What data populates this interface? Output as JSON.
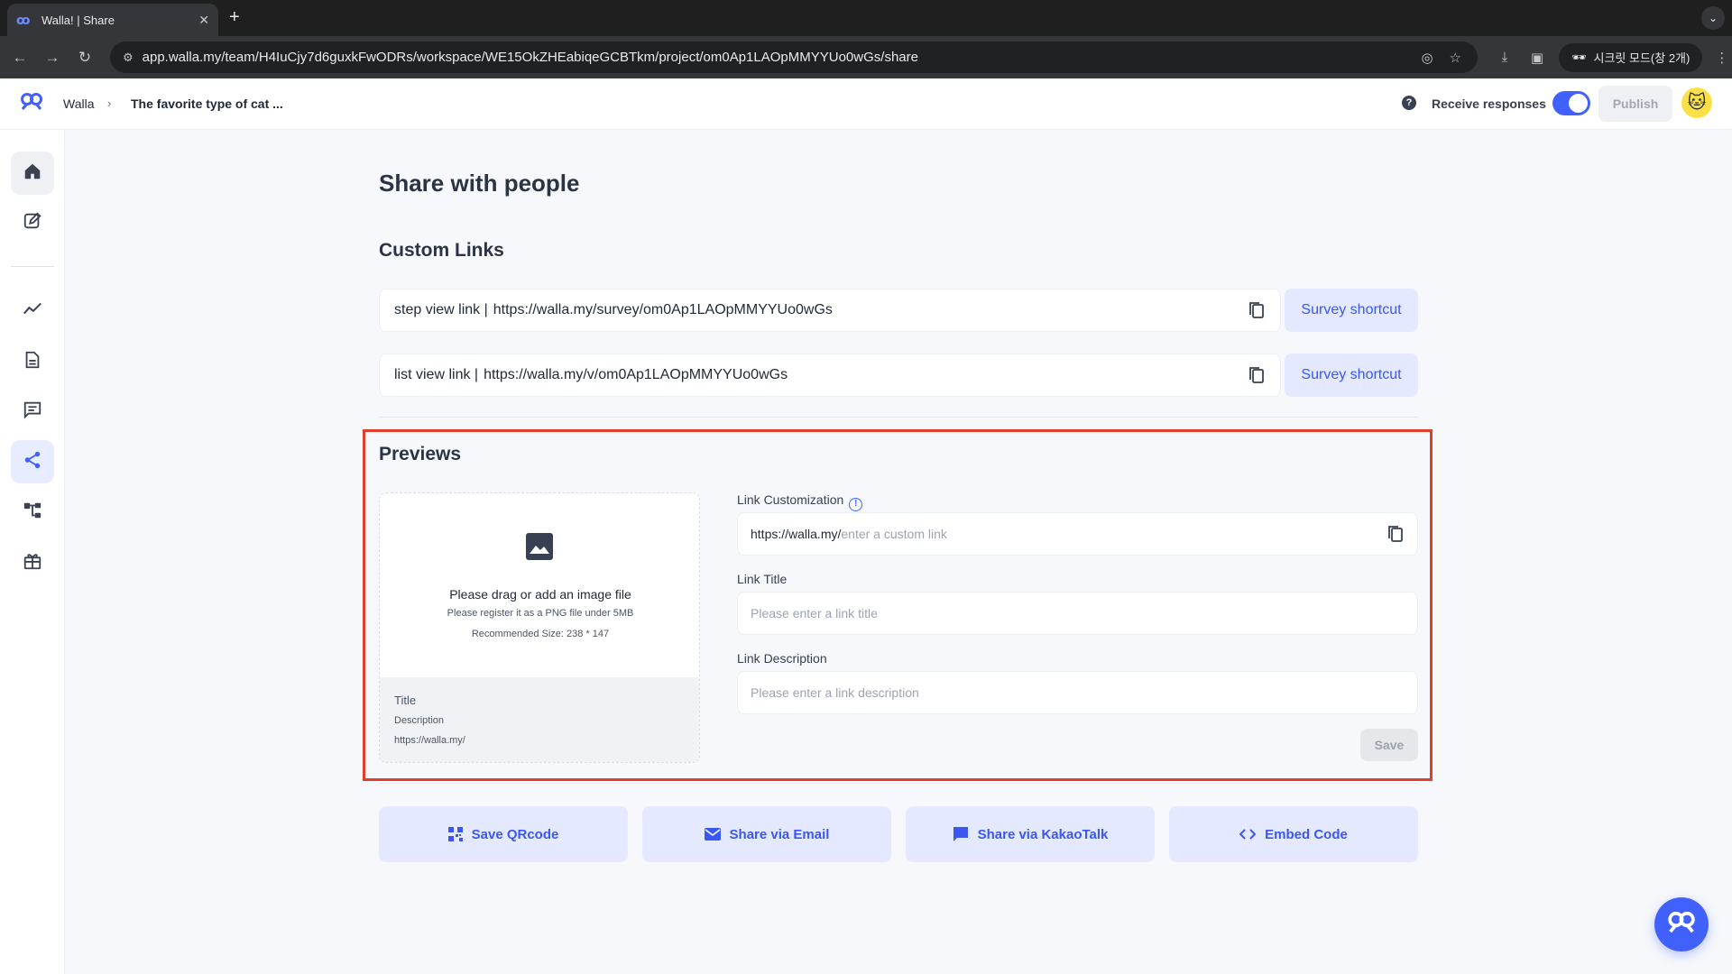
{
  "browser": {
    "tab_title": "Walla! | Share",
    "tab_favicon": "walla-logo-icon",
    "url": "app.walla.my/team/H4IuCjy7d6guxkFwODRs/workspace/WE15OkZHEabiqeGCBTkm/project/om0Ap1LAOpMMYYUo0wGs/share",
    "incognito_label": "시크릿 모드(창 2개)"
  },
  "header": {
    "app_name": "Walla",
    "breadcrumb_sep": "›",
    "project_name": "The favorite type of cat ...",
    "help_label": "?",
    "receive_responses_label": "Receive responses",
    "receive_responses_on": true,
    "publish_label": "Publish"
  },
  "sidebar": {
    "items": [
      {
        "name": "home",
        "icon": "home-icon"
      },
      {
        "name": "edit",
        "icon": "edit-icon"
      },
      {
        "name": "analytics",
        "icon": "trend-icon"
      },
      {
        "name": "document",
        "icon": "document-icon"
      },
      {
        "name": "responses",
        "icon": "chat-icon"
      },
      {
        "name": "share",
        "icon": "share-icon",
        "active": true
      },
      {
        "name": "integrations",
        "icon": "flow-icon"
      },
      {
        "name": "rewards",
        "icon": "gift-icon"
      }
    ]
  },
  "main": {
    "page_title": "Share with people",
    "custom_links_title": "Custom Links",
    "links": [
      {
        "label": "step view link |",
        "url": "https://walla.my/survey/om0Ap1LAOpMMYYUo0wGs",
        "shortcut_label": "Survey shortcut"
      },
      {
        "label": "list view link |",
        "url": "https://walla.my/v/om0Ap1LAOpMMYYUo0wGs",
        "shortcut_label": "Survey shortcut"
      }
    ],
    "previews_title": "Previews",
    "preview_card": {
      "upload_title": "Please drag or add an image file",
      "upload_hint1": "Please register it as a PNG file under 5MB",
      "upload_hint2": "Recommended Size: 238 * 147",
      "title": "Title",
      "description": "Description",
      "url": "https://walla.my/"
    },
    "form": {
      "custom_label": "Link Customization",
      "custom_prefix": "https://walla.my/",
      "custom_placeholder": "enter a custom link",
      "title_label": "Link Title",
      "title_placeholder": "Please enter a link title",
      "desc_label": "Link Description",
      "desc_placeholder": "Please enter a link description",
      "save_label": "Save"
    },
    "actions": [
      {
        "label": "Save QRcode",
        "icon": "qrcode-icon"
      },
      {
        "label": "Share via Email",
        "icon": "email-icon"
      },
      {
        "label": "Share via KakaoTalk",
        "icon": "message-icon"
      },
      {
        "label": "Embed Code",
        "icon": "code-icon"
      }
    ]
  },
  "colors": {
    "accent": "#4161ff",
    "highlight_box": "#e0402a",
    "button_bg": "#e4e9ff"
  }
}
